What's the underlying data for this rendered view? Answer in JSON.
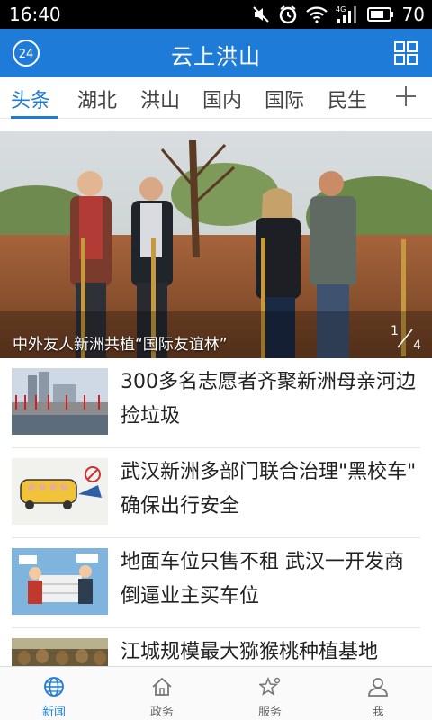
{
  "status_bar": {
    "time": "16:40",
    "network": "4G",
    "battery": "70",
    "icons": [
      "mute-icon",
      "alarm-icon",
      "wifi-icon",
      "signal-icon",
      "battery-icon"
    ]
  },
  "header": {
    "badge": "24",
    "title": "云上洪山",
    "menu_icon": "grid-icon"
  },
  "tabs": [
    {
      "label": "头条",
      "active": true
    },
    {
      "label": "湖北",
      "active": false
    },
    {
      "label": "洪山",
      "active": false
    },
    {
      "label": "国内",
      "active": false
    },
    {
      "label": "国际",
      "active": false
    },
    {
      "label": "民生",
      "active": false
    }
  ],
  "tab_more_icon": "plus-icon",
  "hero": {
    "caption": "中外友人新洲共植“国际友谊林”",
    "current": "1",
    "total": "4"
  },
  "news": [
    {
      "title": "300多名志愿者齐聚新洲母亲河边捡垃圾"
    },
    {
      "title": "武汉新洲多部门联合治理\"黑校车\" 确保出行安全"
    },
    {
      "title": "地面车位只售不租 武汉一开发商倒逼业主买车位"
    },
    {
      "title": "江城规模最大猕猴桃种植基地"
    }
  ],
  "bottom_nav": [
    {
      "label": "新闻",
      "icon": "globe-icon",
      "active": true
    },
    {
      "label": "政务",
      "icon": "home-icon",
      "active": false
    },
    {
      "label": "服务",
      "icon": "star-icon",
      "active": false
    },
    {
      "label": "我",
      "icon": "user-icon",
      "active": false
    }
  ],
  "colors": {
    "accent": "#1e7bd7",
    "status_bar": "#000000",
    "text": "#222222"
  }
}
